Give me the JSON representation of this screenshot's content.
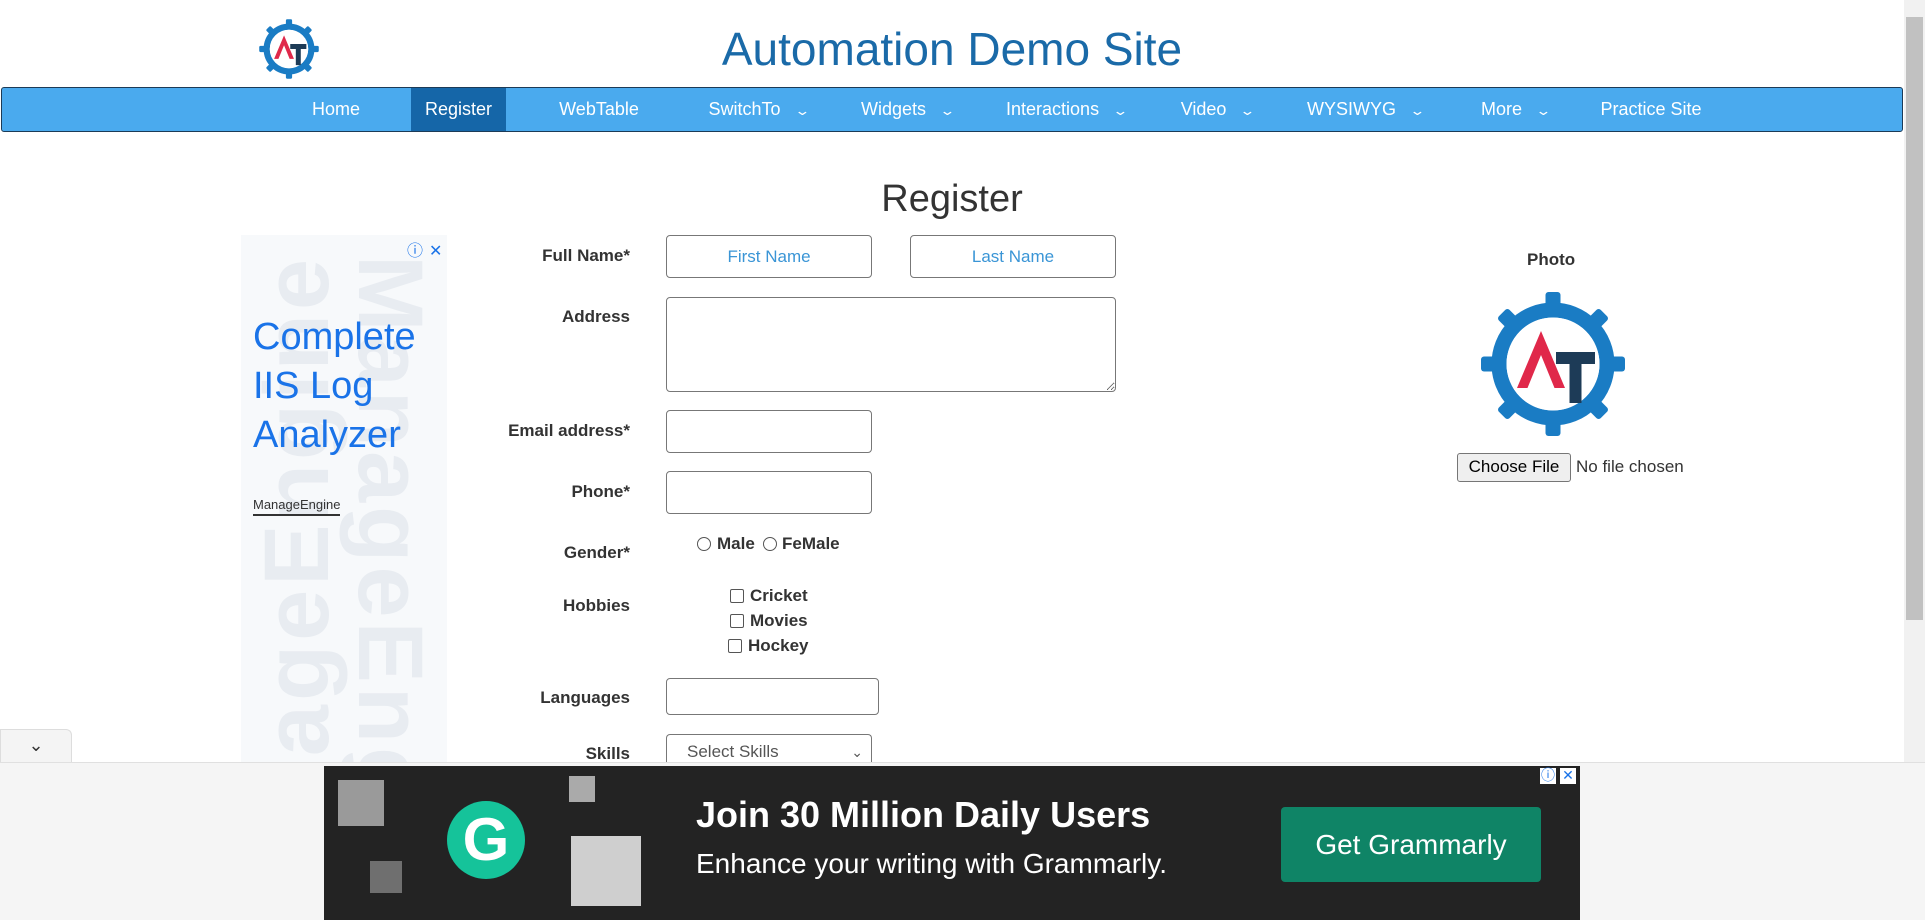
{
  "header": {
    "site_title": "Automation Demo Site"
  },
  "nav": {
    "items": [
      {
        "label": "Home"
      },
      {
        "label": "Register"
      },
      {
        "label": "WebTable"
      },
      {
        "label": "SwitchTo"
      },
      {
        "label": "Widgets"
      },
      {
        "label": "Interactions"
      },
      {
        "label": "Video"
      },
      {
        "label": "WYSIWYG"
      },
      {
        "label": "More"
      },
      {
        "label": "Practice Site"
      }
    ],
    "active": "Register",
    "accent_color": "#4aaaee",
    "active_color": "#1566a8"
  },
  "form": {
    "title": "Register",
    "full_name_label": "Full Name*",
    "first_name_placeholder": "First Name",
    "last_name_placeholder": "Last Name",
    "address_label": "Address",
    "email_label": "Email address*",
    "phone_label": "Phone*",
    "gender_label": "Gender*",
    "gender_options": [
      "Male",
      "FeMale"
    ],
    "hobbies_label": "Hobbies",
    "hobbies": [
      "Cricket",
      "Movies",
      "Hockey"
    ],
    "languages_label": "Languages",
    "skills_label": "Skills",
    "skills_selected": "Select Skills"
  },
  "photo": {
    "label": "Photo",
    "choose_button": "Choose File",
    "no_file": "No file chosen"
  },
  "left_ad": {
    "headline": "Complete IIS Log Analyzer",
    "brand": "ManageEngine",
    "watermark": "ManageEngine"
  },
  "bottom_ad": {
    "title": "Join 30 Million Daily Users",
    "subtitle": "Enhance your writing with Grammarly.",
    "cta": "Get Grammarly",
    "logo_letter": "G",
    "brand_color": "#15c39a",
    "cta_color": "#0f8466"
  },
  "icons": {
    "collapse": "chevron-down-icon",
    "ad_info": "info-icon",
    "ad_close": "close-icon"
  }
}
